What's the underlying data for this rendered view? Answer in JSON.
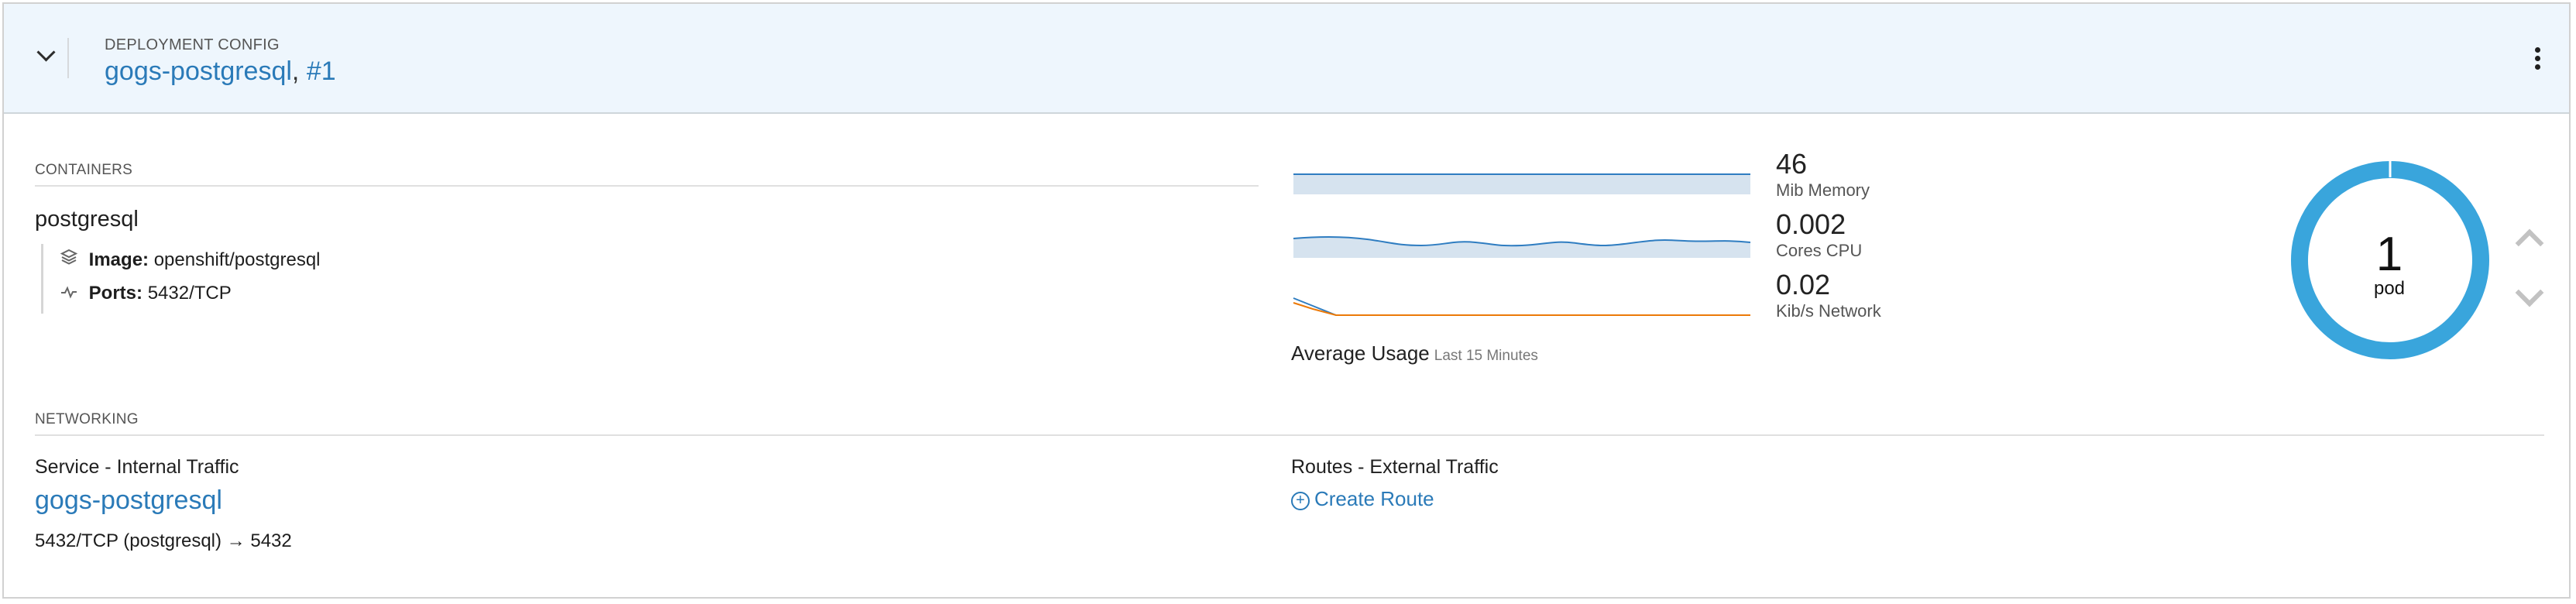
{
  "header": {
    "eyebrow": "DEPLOYMENT CONFIG",
    "name": "gogs-postgresql",
    "separator": ",",
    "revision": "#1"
  },
  "containers": {
    "section_label": "CONTAINERS",
    "name": "postgresql",
    "image_label": "Image:",
    "image_value": "openshift/postgresql",
    "ports_label": "Ports:",
    "ports_value": "5432/TCP"
  },
  "metrics": {
    "memory": {
      "value": "46",
      "unit": "Mib Memory"
    },
    "cpu": {
      "value": "0.002",
      "unit": "Cores CPU"
    },
    "network": {
      "value": "0.02",
      "unit": "Kib/s Network"
    },
    "usage_title": "Average Usage",
    "usage_period": "Last 15 Minutes",
    "colors": {
      "line": "#2f7dc1",
      "fill": "#d6e3ef",
      "network_out": "#ec7a08"
    }
  },
  "pods": {
    "count": "1",
    "label": "pod",
    "ring_color": "#39a5dc",
    "scale_up_icon": "chevron-up-icon",
    "scale_down_icon": "chevron-down-icon"
  },
  "networking": {
    "section_label": "NETWORKING",
    "service_heading": "Service - Internal Traffic",
    "service_name": "gogs-postgresql",
    "port_mapping": "5432/TCP (postgresql) → 5432",
    "routes_heading": "Routes - External Traffic",
    "create_route": "Create Route"
  }
}
